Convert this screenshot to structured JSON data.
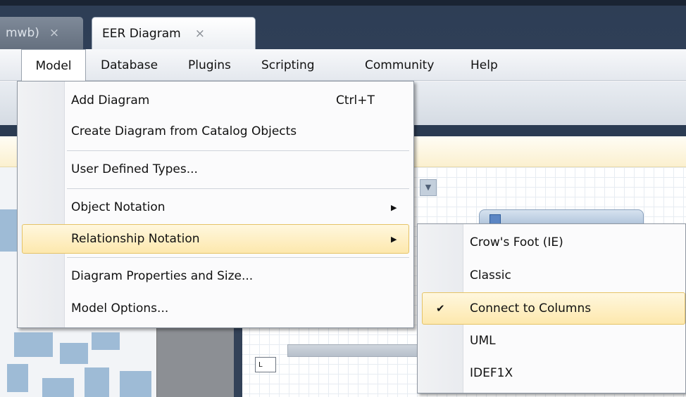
{
  "tabs": [
    {
      "label": "mwb)",
      "close": "×"
    },
    {
      "label": "EER Diagram",
      "close": "×"
    }
  ],
  "menubar": [
    "Model",
    "Database",
    "Plugins",
    "Scripting",
    "Community",
    "Help"
  ],
  "model_menu": {
    "add_diagram": {
      "label": "Add Diagram",
      "shortcut": "Ctrl+T"
    },
    "create_from_catalog": {
      "label": "Create Diagram from Catalog Objects"
    },
    "user_types": {
      "label": "User Defined Types..."
    },
    "object_notation": {
      "label": "Object Notation",
      "arrow": "▶"
    },
    "relationship_notation": {
      "label": "Relationship Notation",
      "arrow": "▶"
    },
    "diagram_properties": {
      "label": "Diagram Properties and Size..."
    },
    "model_options": {
      "label": "Model Options..."
    }
  },
  "relationship_submenu": {
    "items": [
      "Crow's Foot (IE)",
      "Classic",
      "Connect to Columns",
      "UML",
      "IDEF1X"
    ],
    "checked_index": 2,
    "check_glyph": "✔"
  },
  "colors": {
    "highlight": "#fde8ad",
    "dark_chrome": "#2f3f57",
    "square_blue": "#9ebbd6"
  }
}
